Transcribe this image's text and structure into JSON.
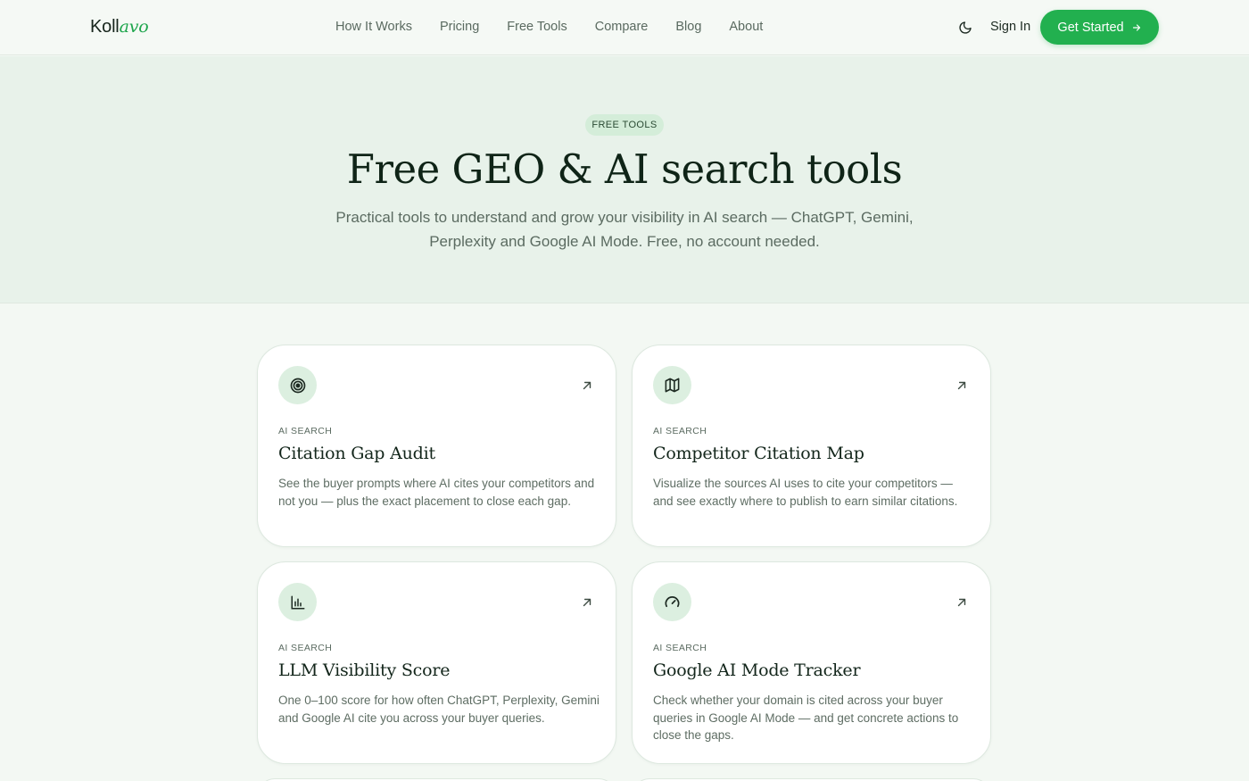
{
  "header": {
    "logo_main": "Koll",
    "logo_accent": "avo",
    "nav": [
      "How It Works",
      "Pricing",
      "Free Tools",
      "Compare",
      "Blog",
      "About"
    ],
    "theme_icon": "moon-icon",
    "sign_in": "Sign In",
    "cta": "Get Started",
    "cta_icon": "arrow-right-icon"
  },
  "hero": {
    "badge": "FREE TOOLS",
    "title": "Free GEO & AI search tools",
    "subtitle": "Practical tools to understand and grow your visibility in AI search — ChatGPT, Gemini, Perplexity and Google AI Mode. Free, no account needed."
  },
  "tools": [
    {
      "icon": "target-icon",
      "eyebrow": "AI SEARCH",
      "title": "Citation Gap Audit",
      "description": "See the buyer prompts where AI cites your competitors and not you — plus the exact placement to close each gap."
    },
    {
      "icon": "map-icon",
      "eyebrow": "AI SEARCH",
      "title": "Competitor Citation Map",
      "description": "Visualize the sources AI uses to cite your competitors — and see exactly where to publish to earn similar citations."
    },
    {
      "icon": "bar-chart-icon",
      "eyebrow": "AI SEARCH",
      "title": "LLM Visibility Score",
      "description": "One 0–100 score for how often ChatGPT, Perplexity, Gemini and Google AI cite you across your buyer queries."
    },
    {
      "icon": "gauge-icon",
      "eyebrow": "AI SEARCH",
      "title": "Google AI Mode Tracker",
      "description": "Check whether your domain is cited across your buyer queries in Google AI Mode — and get concrete actions to close the gaps."
    }
  ],
  "colors": {
    "accent": "#22b04f",
    "hero_bg": "#e8f2ea",
    "page_bg": "#f3f8f3",
    "icon_bg": "#dcefe0"
  }
}
